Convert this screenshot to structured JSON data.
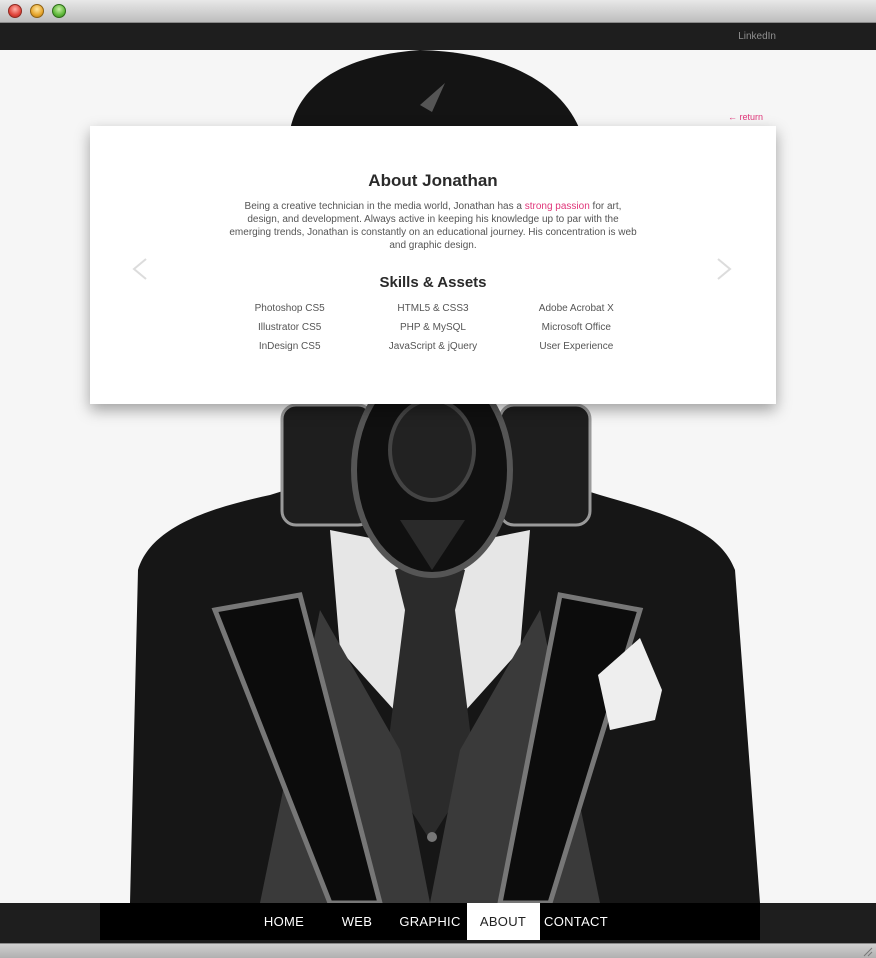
{
  "header": {
    "linkedin_label": "LinkedIn"
  },
  "card": {
    "return_label": "← return",
    "title": "About Jonathan",
    "intro_before": "Being a creative technician in the media world, Jonathan has a ",
    "intro_highlight": "strong passion",
    "intro_after": " for art, design, and development. Always active in keeping his knowledge up to par with the emerging trends, Jonathan is constantly on an educational journey. His concentration is web and graphic design.",
    "skills_title": "Skills & Assets",
    "skills": [
      "Photoshop CS5",
      "HTML5 & CSS3",
      "Adobe Acrobat X",
      "Illustrator CS5",
      "PHP & MySQL",
      "Microsoft Office",
      "InDesign CS5",
      "JavaScript & jQuery",
      "User Experience"
    ]
  },
  "nav": {
    "items": [
      {
        "label": "HOME"
      },
      {
        "label": "WEB"
      },
      {
        "label": "GRAPHIC"
      },
      {
        "label": "ABOUT"
      },
      {
        "label": "CONTACT"
      }
    ],
    "active_index": 3
  },
  "colors": {
    "accent": "#e0367a",
    "bar": "#1e1e1e",
    "card": "#ffffff",
    "text": "#2a2a2a"
  }
}
